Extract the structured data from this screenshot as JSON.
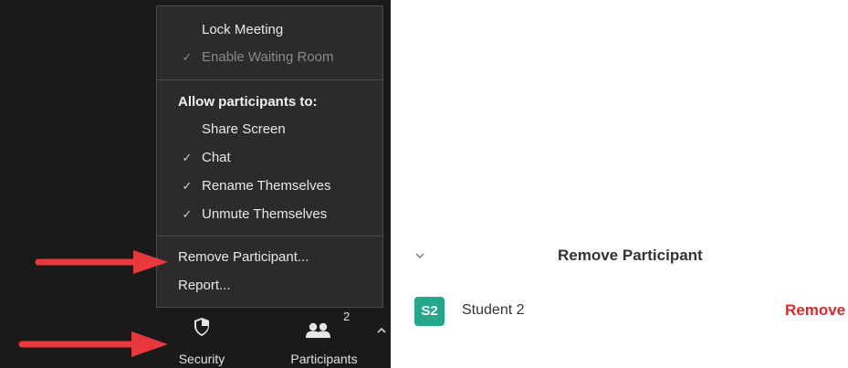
{
  "security_menu": {
    "lock_meeting": "Lock Meeting",
    "enable_waiting_room": "Enable Waiting Room",
    "allow_heading": "Allow participants to:",
    "share_screen": "Share Screen",
    "chat": "Chat",
    "rename_themselves": "Rename Themselves",
    "unmute_themselves": "Unmute Themselves",
    "remove_participant": "Remove Participant...",
    "report": "Report...",
    "check_glyph": "✓"
  },
  "toolbar": {
    "security_label": "Security",
    "participants_label": "Participants",
    "participants_count": "2",
    "security_icon": "shield-icon",
    "participants_icon": "people-icon"
  },
  "remove_dialog": {
    "title": "Remove Participant",
    "participant": {
      "initials": "S2",
      "name": "Student 2",
      "avatar_color": "#23a889"
    },
    "remove_label": "Remove"
  },
  "colors": {
    "arrow": "#e8383b",
    "remove": "#e02828",
    "dark_bg": "#1a1a1a",
    "menu_bg": "#2b2b2b"
  }
}
